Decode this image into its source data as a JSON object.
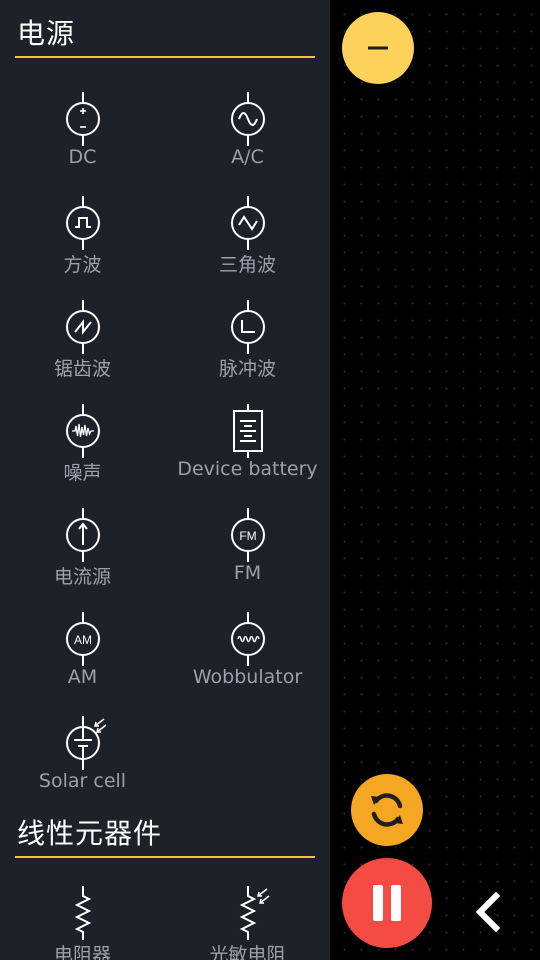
{
  "sections": {
    "power": {
      "title": "电源",
      "items": [
        {
          "label": "DC",
          "icon": "dc-source-icon"
        },
        {
          "label": "A/C",
          "icon": "ac-source-icon"
        },
        {
          "label": "方波",
          "icon": "square-wave-icon"
        },
        {
          "label": "三角波",
          "icon": "triangle-wave-icon"
        },
        {
          "label": "锯齿波",
          "icon": "sawtooth-wave-icon"
        },
        {
          "label": "脉冲波",
          "icon": "pulse-wave-icon"
        },
        {
          "label": "噪声",
          "icon": "noise-source-icon"
        },
        {
          "label": "Device battery",
          "icon": "battery-icon"
        },
        {
          "label": "电流源",
          "icon": "current-source-icon"
        },
        {
          "label": "FM",
          "icon": "fm-source-icon",
          "icon_text": "FM"
        },
        {
          "label": "AM",
          "icon": "am-source-icon",
          "icon_text": "AM"
        },
        {
          "label": "Wobbulator",
          "icon": "wobbulator-icon"
        },
        {
          "label": "Solar cell",
          "icon": "solar-cell-icon"
        }
      ]
    },
    "linear": {
      "title": "线性元器件",
      "items": [
        {
          "label": "电阻器",
          "icon": "resistor-icon"
        },
        {
          "label": "光敏电阻",
          "icon": "photoresistor-icon"
        }
      ]
    }
  },
  "colors": {
    "panel_bg": "#1d2128",
    "accent_yellow": "#f7c335",
    "label_gray": "#9aa1ab",
    "collapse_fab": "#fcd25a",
    "refresh_fab": "#f5a623",
    "pause_fab": "#f44b43"
  },
  "controls": {
    "collapse_icon": "minus-icon",
    "refresh_icon": "refresh-icon",
    "pause_icon": "pause-icon",
    "back_icon": "chevron-left-icon"
  }
}
